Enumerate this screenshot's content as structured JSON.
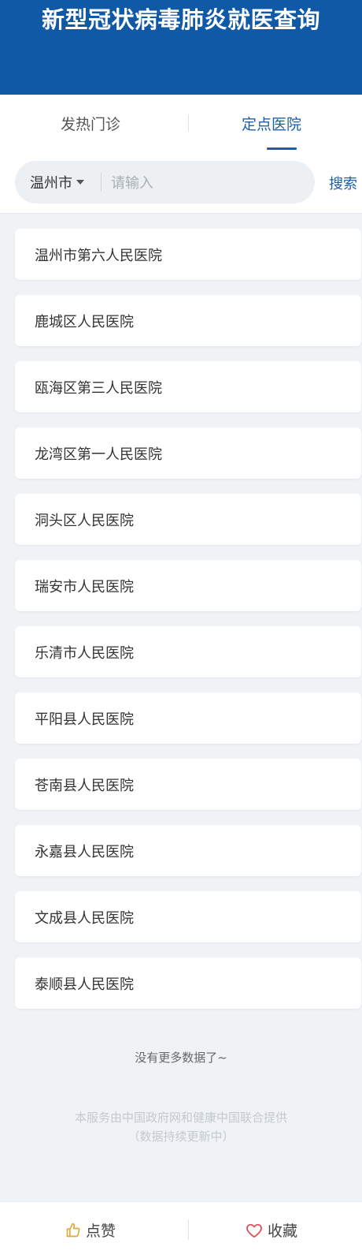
{
  "header": {
    "title": "新型冠状病毒肺炎就医查询"
  },
  "tabs": [
    {
      "label": "发热门诊",
      "active": false
    },
    {
      "label": "定点医院",
      "active": true
    }
  ],
  "search": {
    "city": "温州市",
    "placeholder": "请输入",
    "value": "",
    "button_label": "搜索"
  },
  "hospitals": [
    "温州市第六人民医院",
    "鹿城区人民医院",
    "瓯海区第三人民医院",
    "龙湾区第一人民医院",
    "洞头区人民医院",
    "瑞安市人民医院",
    "乐清市人民医院",
    "平阳县人民医院",
    "苍南县人民医院",
    "永嘉县人民医院",
    "文成县人民医院",
    "泰顺县人民医院"
  ],
  "no_more_text": "没有更多数据了~",
  "footer_note": {
    "line1": "本服务由中国政府网和健康中国联合提供",
    "line2": "（数据持续更新中）"
  },
  "bottom_bar": {
    "like_label": "点赞",
    "like_icon": "thumbs-up-icon",
    "favorite_label": "收藏",
    "favorite_icon": "heart-icon"
  },
  "colors": {
    "header_bg": "#1059a6",
    "accent": "#1a5fa8",
    "page_bg": "#f0f3f6",
    "like_icon": "#e0a83a",
    "favorite_icon": "#e0505a"
  }
}
